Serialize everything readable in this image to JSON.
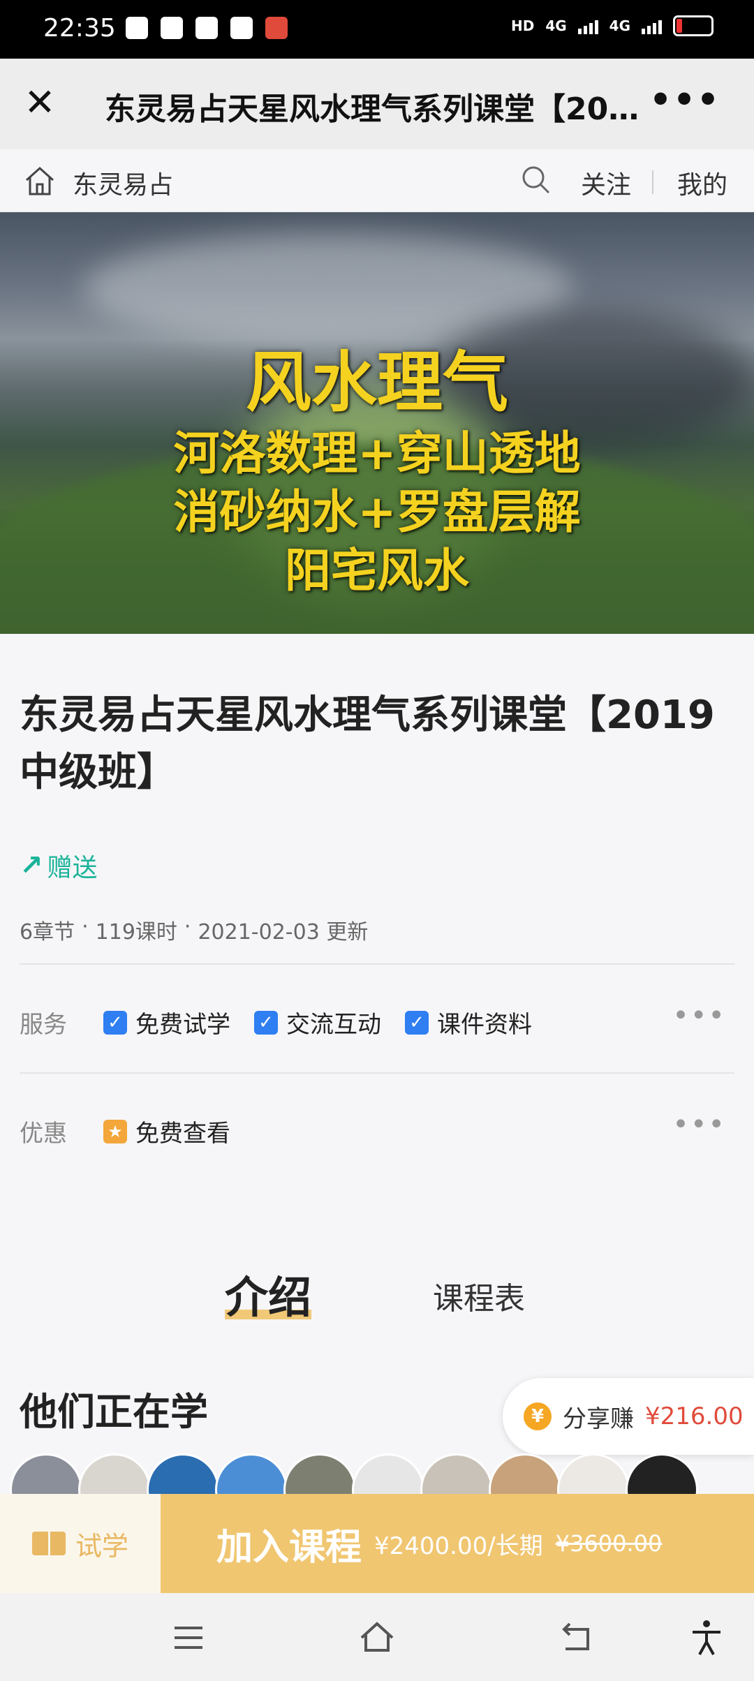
{
  "status_bar": {
    "time": "22:35",
    "network1": "4G",
    "network2": "4G",
    "hd": "HD"
  },
  "title_bar": {
    "title": "东灵易占天星风水理气系列课堂【2019中级班】"
  },
  "shop_nav": {
    "shop_name": "东灵易占",
    "follow_label": "关注",
    "mine_label": "我的"
  },
  "banner": {
    "line1": "风水理气",
    "line2": "河洛数理+穿山透地",
    "line3": "消砂纳水+罗盘层解",
    "line4": "阳宅风水"
  },
  "course": {
    "title": "东灵易占天星风水理气系列课堂【2019中级班】",
    "gift_label": "赠送",
    "meta": [
      "6章节",
      "·",
      "119课时",
      "·",
      "2021-02-03 更新"
    ]
  },
  "services": {
    "label": "服务",
    "items": [
      "免费试学",
      "交流互动",
      "课件资料"
    ]
  },
  "discount": {
    "label": "优惠",
    "item": "免费查看"
  },
  "tabs": {
    "intro": "介绍",
    "schedule": "课程表"
  },
  "learning": {
    "title": "他们正在学"
  },
  "share": {
    "label": "分享赚",
    "amount": "¥216.00"
  },
  "action_bar": {
    "trial_label": "试学",
    "join_label": "加入课程",
    "price": "¥2400.00/长期",
    "original_price": "¥3600.00"
  },
  "colors": {
    "accent_green": "#1bb39a",
    "check_blue": "#2f7ef2",
    "join_gold": "#f0c671",
    "price_red": "#e04b3b"
  }
}
